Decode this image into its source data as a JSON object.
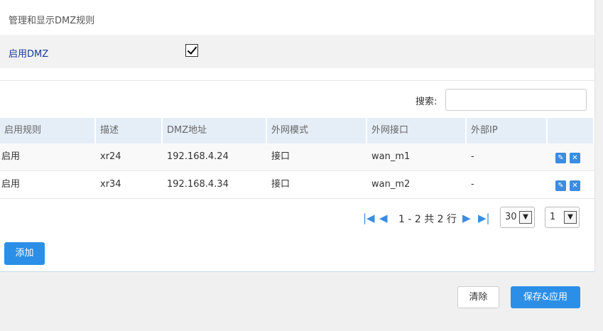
{
  "section": {
    "title": "管理和显示DMZ规则"
  },
  "dmz_toggle": {
    "label": "启用DMZ",
    "checked": true
  },
  "search": {
    "label": "搜索:",
    "value": "",
    "placeholder": ""
  },
  "table": {
    "headers": [
      "启用规则",
      "描述",
      "DMZ地址",
      "外网模式",
      "外网接口",
      "外部IP",
      ""
    ],
    "rows": [
      {
        "enabled": "启用",
        "desc": "xr24",
        "dmz_addr": "192.168.4.24",
        "wan_mode": "接口",
        "wan_iface": "wan_m1",
        "ext_ip": "-"
      },
      {
        "enabled": "启用",
        "desc": "xr34",
        "dmz_addr": "192.168.4.34",
        "wan_mode": "接口",
        "wan_iface": "wan_m2",
        "ext_ip": "-"
      }
    ],
    "action_icons": [
      "edit-icon",
      "delete-icon"
    ]
  },
  "pager": {
    "summary": "1 - 2 共 2 行",
    "page_size": "30",
    "page": "1",
    "icons": [
      "first-page-icon",
      "prev-page-icon",
      "next-page-icon",
      "last-page-icon"
    ]
  },
  "buttons": {
    "add": "添加",
    "clear": "清除",
    "save_apply": "保存&应用"
  },
  "colors": {
    "accent": "#2b8fe8",
    "header_bg": "#e5eef7",
    "label_blue": "#1a3a9a"
  }
}
